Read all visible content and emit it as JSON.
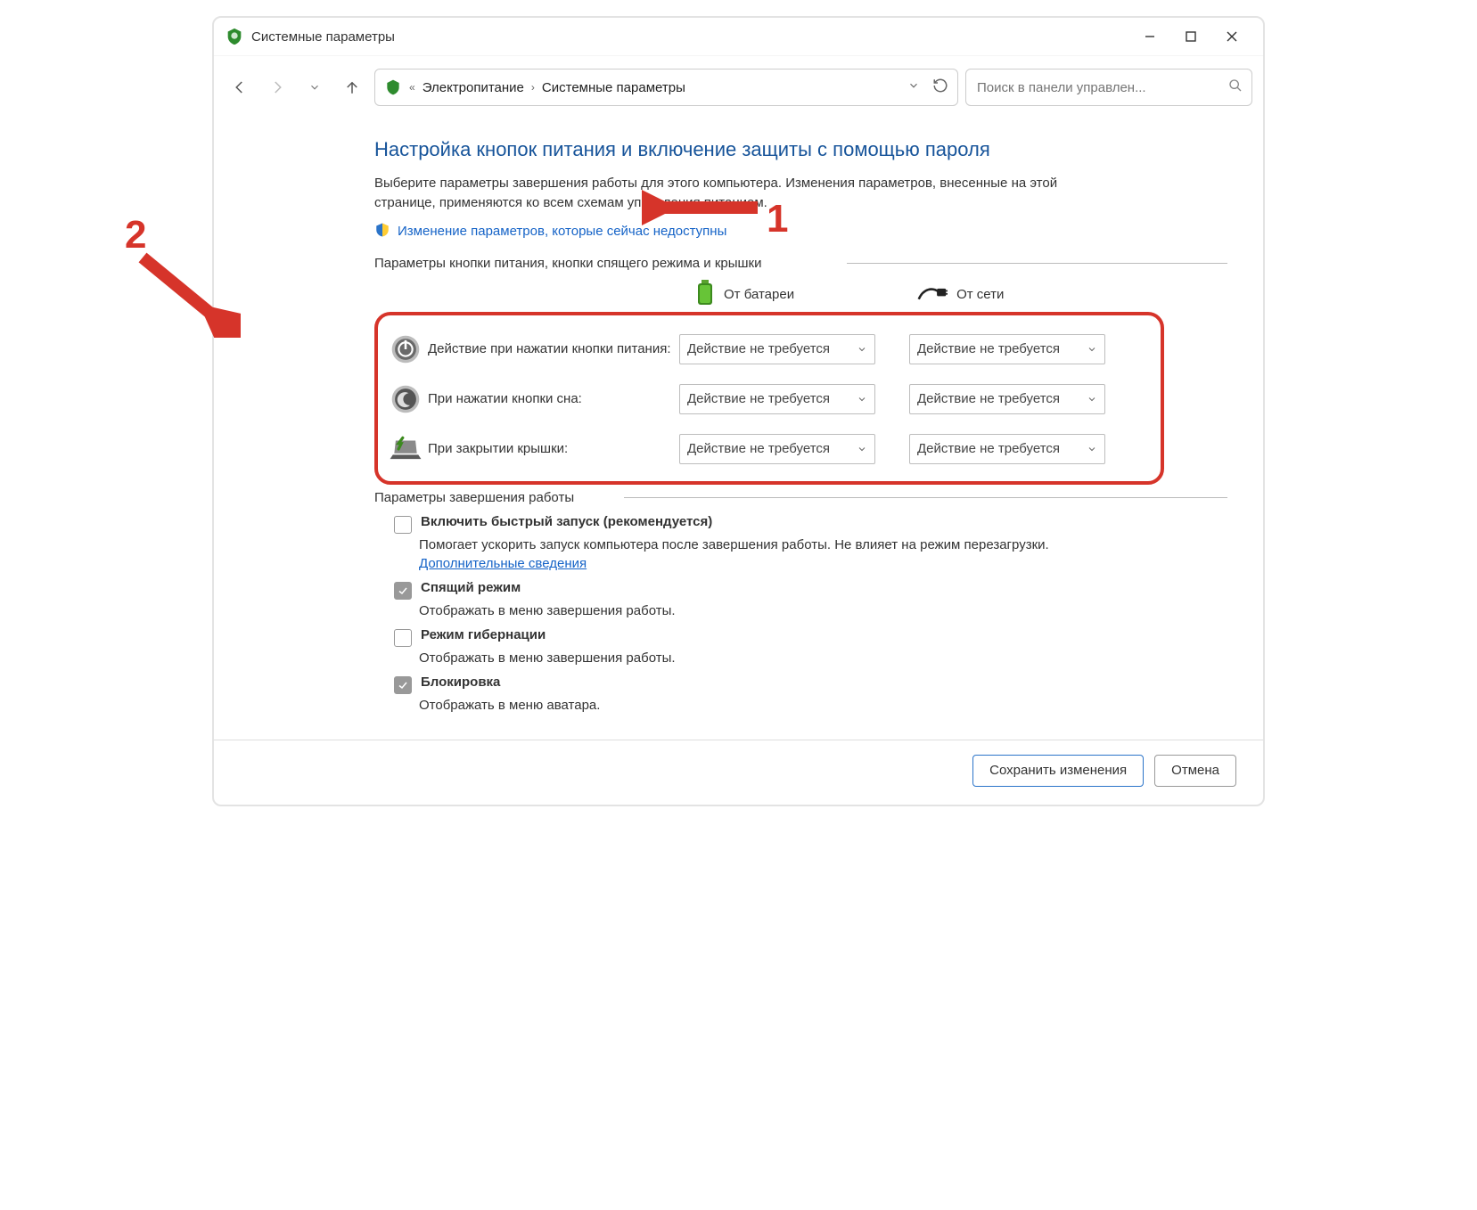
{
  "window": {
    "title": "Системные параметры"
  },
  "breadcrumb": {
    "parent": "Электропитание",
    "current": "Системные параметры"
  },
  "search": {
    "placeholder": "Поиск в панели управлен..."
  },
  "heading": "Настройка кнопок питания и включение защиты с помощью пароля",
  "description": "Выберите параметры завершения работы для этого компьютера. Изменения параметров, внесенные на этой странице, применяются ко всем схемам управления питанием.",
  "change_link": "Изменение параметров, которые сейчас недоступны",
  "section1": "Параметры кнопки питания, кнопки спящего режима и крышки",
  "cols": {
    "battery": "От батареи",
    "ac": "От сети"
  },
  "no_action": "Действие не требуется",
  "rows": {
    "power": {
      "label": "Действие при нажатии кнопки питания:"
    },
    "sleep": {
      "label": "При нажатии кнопки сна:"
    },
    "lid": {
      "label": "При закрытии крышки:"
    }
  },
  "section2": "Параметры завершения работы",
  "shutdown": {
    "fast": {
      "title": "Включить быстрый запуск (рекомендуется)",
      "sub_a": "Помогает ускорить запуск компьютера после завершения работы. Не влияет на режим перезагрузки. ",
      "more": "Дополнительные сведения"
    },
    "sleep": {
      "title": "Спящий режим",
      "sub": "Отображать в меню завершения работы."
    },
    "hiber": {
      "title": "Режим гибернации",
      "sub": "Отображать в меню завершения работы."
    },
    "lock": {
      "title": "Блокировка",
      "sub": "Отображать в меню аватара."
    }
  },
  "buttons": {
    "save": "Сохранить изменения",
    "cancel": "Отмена"
  },
  "annot": {
    "one": "1",
    "two": "2"
  }
}
